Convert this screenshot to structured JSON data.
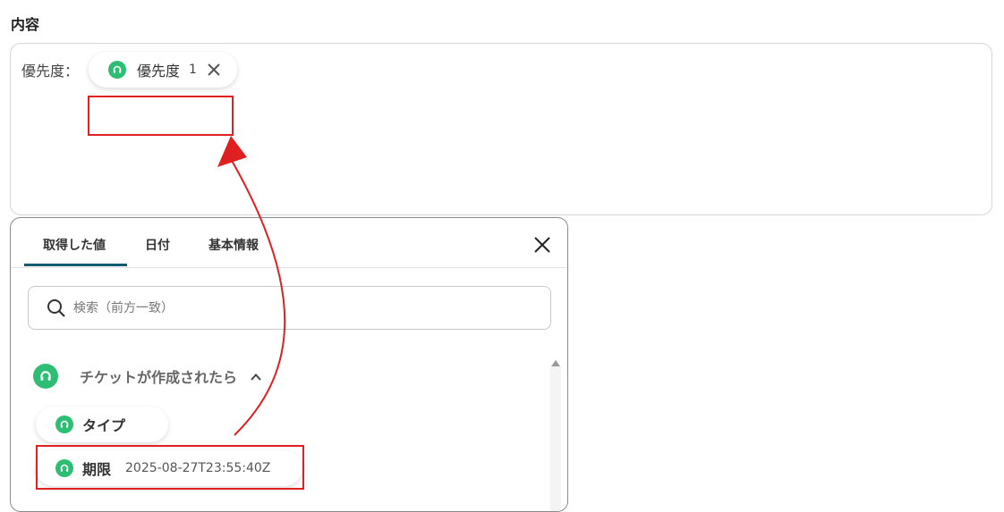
{
  "section": {
    "label": "内容"
  },
  "content_field": {
    "prefix": "優先度：",
    "chip": {
      "label": "優先度",
      "number": "1"
    }
  },
  "panel": {
    "tabs": [
      {
        "label": "取得した値",
        "active": true
      },
      {
        "label": "日付",
        "active": false
      },
      {
        "label": "基本情報",
        "active": false
      }
    ],
    "search": {
      "placeholder": "検索（前方一致）",
      "value": ""
    },
    "group": {
      "title": "チケットが作成されたら",
      "items": [
        {
          "label": "タイプ",
          "value": ""
        },
        {
          "label": "期限",
          "value": "2025-08-27T23:55:40Z"
        }
      ]
    }
  },
  "colors": {
    "accent": "#0f5b70",
    "brand_green": "#2dbe73",
    "highlight_red": "#e02020"
  },
  "icons": {
    "chip": "headset-icon",
    "chip_remove": "close-icon",
    "panel_close": "close-icon",
    "search": "search-icon",
    "group": "headset-icon",
    "group_toggle": "chevron-up-icon",
    "scroll": "scroll-up-icon"
  }
}
